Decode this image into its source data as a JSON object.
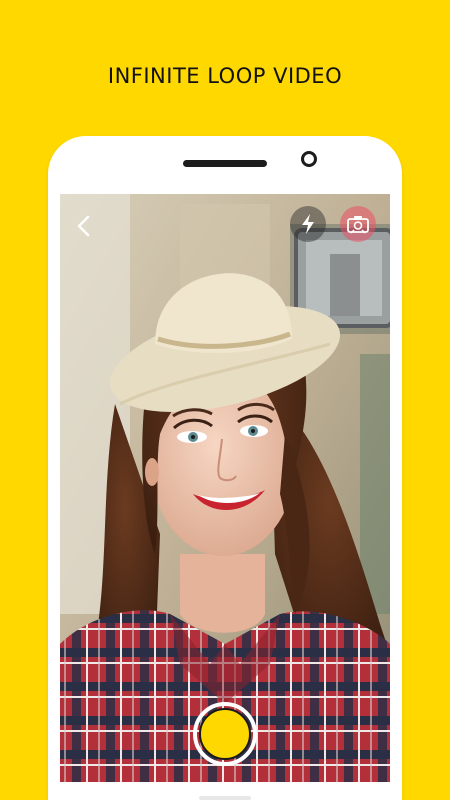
{
  "headline": {
    "text": "INFINITE LOOP VIDEO"
  },
  "camera": {
    "toolbar": {
      "back_icon": "chevron-left-icon",
      "flash_icon": "flash-icon",
      "switch_icon": "camera-switch-icon"
    },
    "shutter_color": "#FFD800"
  },
  "colors": {
    "background": "#FFD800",
    "phone_frame": "#FFFFFF",
    "accent": "#FFD800"
  }
}
